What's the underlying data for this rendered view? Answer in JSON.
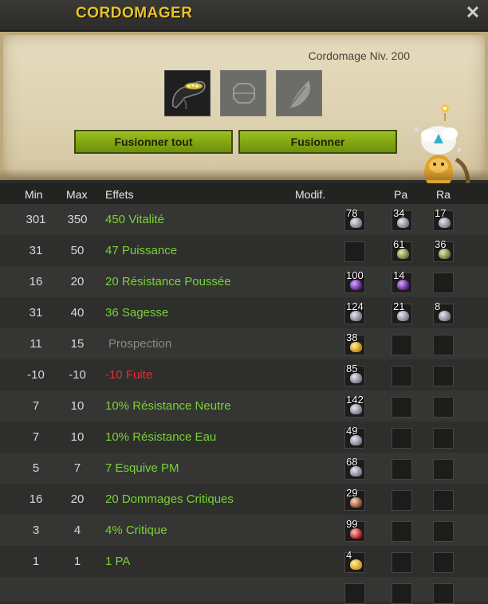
{
  "window": {
    "title": "CORDOMAGER",
    "close_glyph": "✕"
  },
  "panel": {
    "level": "Cordomage Niv. 200",
    "slots": [
      {
        "icon": "item-icon",
        "filled": true
      },
      {
        "icon": "rune-slot-icon",
        "filled": false
      },
      {
        "icon": "feather-icon",
        "filled": false
      }
    ],
    "buttons": {
      "fuse_all": "Fusionner tout",
      "fuse": "Fusionner"
    }
  },
  "table": {
    "headers": {
      "min": "Min",
      "max": "Max",
      "effects": "Effets",
      "modif": "Modif.",
      "pa": "Pa",
      "ra": "Ra"
    },
    "rows": [
      {
        "min": "301",
        "max": "350",
        "effect": "450 Vitalité",
        "style": "green",
        "modif": "78",
        "pa": "34",
        "ra": "17",
        "rune": "grey"
      },
      {
        "min": "31",
        "max": "50",
        "effect": "47 Puissance",
        "style": "green",
        "modif": "",
        "pa": "61",
        "ra": "36",
        "rune": "green"
      },
      {
        "min": "16",
        "max": "20",
        "effect": "20 Résistance Poussée",
        "style": "green",
        "modif": "100",
        "pa": "14",
        "ra": "",
        "rune": "purple"
      },
      {
        "min": "31",
        "max": "40",
        "effect": "36 Sagesse",
        "style": "green",
        "modif": "124",
        "pa": "21",
        "ra": "8",
        "rune": "grey"
      },
      {
        "min": "11",
        "max": "15",
        "effect": "Prospection",
        "style": "grey",
        "modif": "38",
        "pa": "",
        "ra": "",
        "rune": "gold"
      },
      {
        "min": "-10",
        "max": "-10",
        "effect": "-10 Fuite",
        "style": "red",
        "modif": "85",
        "pa": "",
        "ra": "",
        "rune": "grey"
      },
      {
        "min": "7",
        "max": "10",
        "effect": "10% Résistance Neutre",
        "style": "green",
        "modif": "142",
        "pa": "",
        "ra": "",
        "rune": "grey"
      },
      {
        "min": "7",
        "max": "10",
        "effect": "10% Résistance Eau",
        "style": "green",
        "modif": "49",
        "pa": "",
        "ra": "",
        "rune": "grey"
      },
      {
        "min": "5",
        "max": "7",
        "effect": "7 Esquive PM",
        "style": "green",
        "modif": "68",
        "pa": "",
        "ra": "",
        "rune": "grey"
      },
      {
        "min": "16",
        "max": "20",
        "effect": "20 Dommages Critiques",
        "style": "green",
        "modif": "29",
        "pa": "",
        "ra": "",
        "rune": "brown"
      },
      {
        "min": "3",
        "max": "4",
        "effect": "4% Critique",
        "style": "green",
        "modif": "99",
        "pa": "",
        "ra": "",
        "rune": "red"
      },
      {
        "min": "1",
        "max": "1",
        "effect": "1 PA",
        "style": "green",
        "modif": "4",
        "pa": "",
        "ra": "",
        "rune": "yellow"
      }
    ]
  },
  "colors": {
    "title": "#e8c22a",
    "positive": "#79d336",
    "negative": "#e0303a",
    "neutral": "#8a8a88",
    "button": "#8aac15"
  }
}
